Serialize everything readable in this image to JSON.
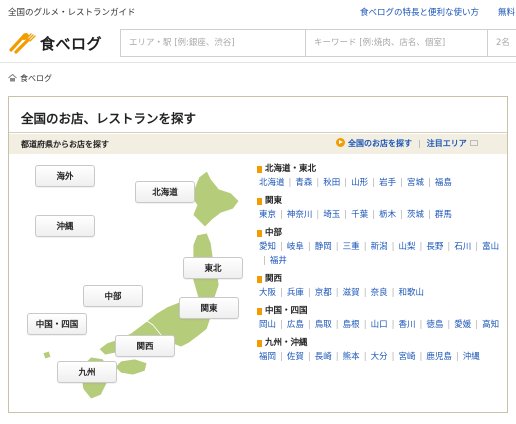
{
  "topbar": {
    "tagline": "全国のグルメ・レストランガイド",
    "features_link": "食べログの特長と便利な使い方",
    "free_link": "無料"
  },
  "header": {
    "logo_text": "食べログ",
    "area_placeholder": "エリア・駅 [例:銀座、渋谷]",
    "keyword_placeholder": "キーワード [例:焼肉、店名、個室]",
    "count_placeholder": "2名"
  },
  "breadcrumb": {
    "home": "食べログ"
  },
  "panel": {
    "title": "全国のお店、レストランを探す",
    "sub_left": "都道府県からお店を探す",
    "sub_right_link": "全国のお店を探す",
    "sub_right_link2": "注目エリア"
  },
  "map": {
    "land_color": "#b5cc7a",
    "buttons": {
      "kaigai": "海外",
      "hokkaido": "北海道",
      "okinawa": "沖縄",
      "tohoku": "東北",
      "chubu": "中部",
      "kanto": "関東",
      "chugoku_shikoku": "中国・四国",
      "kansai": "関西",
      "kyushu": "九州"
    }
  },
  "areas": [
    {
      "title": "北海道・東北",
      "prefs": [
        "北海道",
        "青森",
        "秋田",
        "山形",
        "岩手",
        "宮城",
        "福島"
      ]
    },
    {
      "title": "関東",
      "prefs": [
        "東京",
        "神奈川",
        "埼玉",
        "千葉",
        "栃木",
        "茨城",
        "群馬"
      ]
    },
    {
      "title": "中部",
      "prefs": [
        "愛知",
        "岐阜",
        "静岡",
        "三重",
        "新潟",
        "山梨",
        "長野",
        "石川",
        "富山",
        "福井"
      ]
    },
    {
      "title": "関西",
      "prefs": [
        "大阪",
        "兵庫",
        "京都",
        "滋賀",
        "奈良",
        "和歌山"
      ]
    },
    {
      "title": "中国・四国",
      "prefs": [
        "岡山",
        "広島",
        "鳥取",
        "島根",
        "山口",
        "香川",
        "徳島",
        "愛媛",
        "高知"
      ]
    },
    {
      "title": "九州・沖縄",
      "prefs": [
        "福岡",
        "佐賀",
        "長崎",
        "熊本",
        "大分",
        "宮崎",
        "鹿児島",
        "沖縄"
      ]
    }
  ],
  "colors": {
    "link": "#1a55b8",
    "accent": "#f29c00",
    "panel_border": "#c9c1a8",
    "subbar_bg": "#f2eee2"
  }
}
